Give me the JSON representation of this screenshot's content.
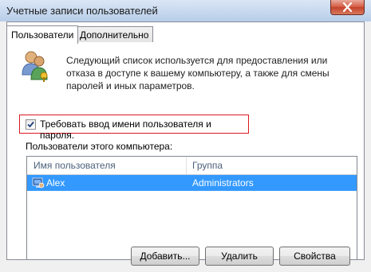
{
  "window": {
    "title": "Учетные записи пользователей"
  },
  "tabs": [
    {
      "label": "Пользователи",
      "active": true
    },
    {
      "label": "Дополнительно",
      "active": false
    }
  ],
  "description": "Следующий список используется для предоставления или отказа в доступе к вашему компьютеру, а также для смены паролей и иных параметров.",
  "require_login": {
    "label": "Требовать ввод имени пользователя и пароля.",
    "checked": true
  },
  "users_section": {
    "label": "Пользователи этого компьютера:",
    "columns": [
      "Имя пользователя",
      "Группа"
    ],
    "rows": [
      {
        "name": "Alex",
        "group": "Administrators",
        "selected": true
      }
    ]
  },
  "buttons": {
    "add": "Добавить...",
    "delete": "Удалить",
    "properties": "Свойства"
  },
  "colors": {
    "selection": "#3399ff",
    "highlight_border": "#d9181f"
  }
}
